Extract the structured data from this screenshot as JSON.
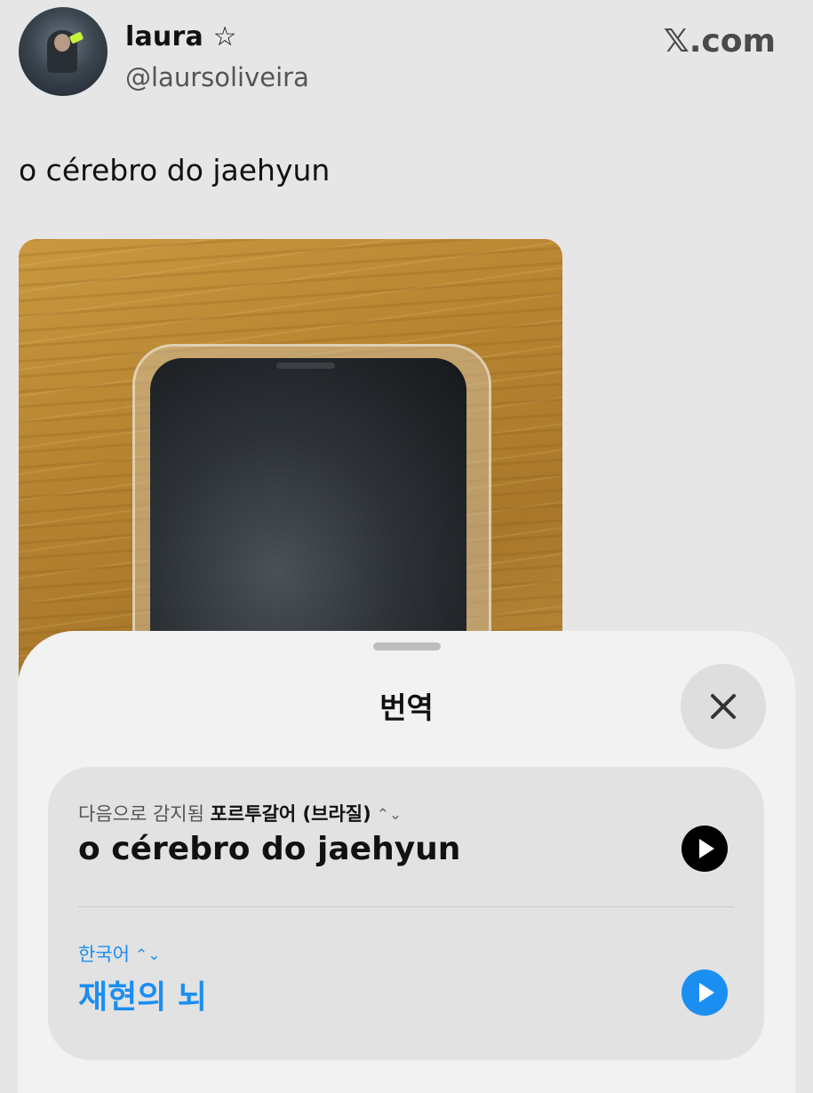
{
  "tweet": {
    "name": "laura ☆",
    "handle": "@laursoliveira",
    "brand": "𝕏.com",
    "text": "o cérebro do jaehyun"
  },
  "sheet": {
    "title": "번역",
    "source": {
      "detected_prefix": "다음으로 감지됨",
      "language": "포르투갈어 (브라질)",
      "text": "o cérebro do jaehyun"
    },
    "target": {
      "language": "한국어",
      "text": "재현의 뇌"
    },
    "chevron_glyph": "⌃⌄"
  },
  "colors": {
    "background": "#e6e6e6",
    "sheet": "#f2f2f2",
    "card": "#e2e2e2",
    "accent_blue": "#1b8ef2"
  },
  "icons": [
    "close-icon",
    "play-icon",
    "chevron-updown-icon"
  ]
}
